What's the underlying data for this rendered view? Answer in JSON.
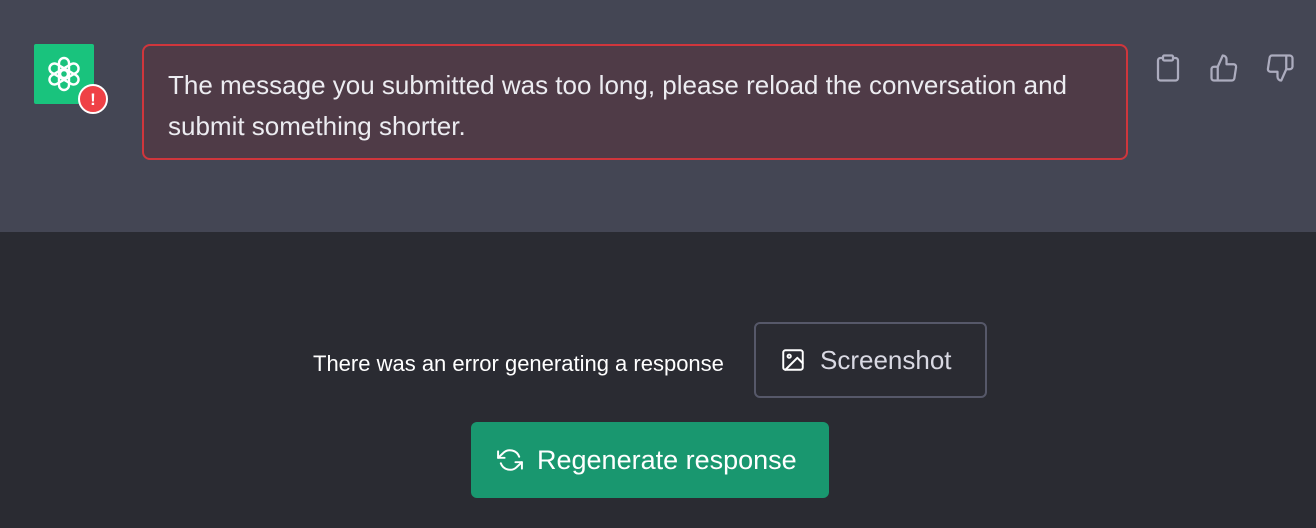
{
  "conversation": {
    "assistant_avatar_icon": "openai-logo-icon",
    "assistant_avatar_color": "#19c37d",
    "error_badge_symbol": "!",
    "error_message": "The message you submitted was too long, please reload the conversation and submit something shorter.",
    "error_color": "#d0363c",
    "actions": [
      {
        "icon": "clipboard-icon"
      },
      {
        "icon": "thumbs-up-icon"
      },
      {
        "icon": "thumbs-down-icon"
      }
    ]
  },
  "footer": {
    "error_text": "There was an error generating a response",
    "screenshot_label": "Screenshot",
    "screenshot_icon": "image-icon",
    "regenerate_label": "Regenerate response",
    "regenerate_icon": "refresh-icon",
    "regenerate_color": "#19976f"
  }
}
